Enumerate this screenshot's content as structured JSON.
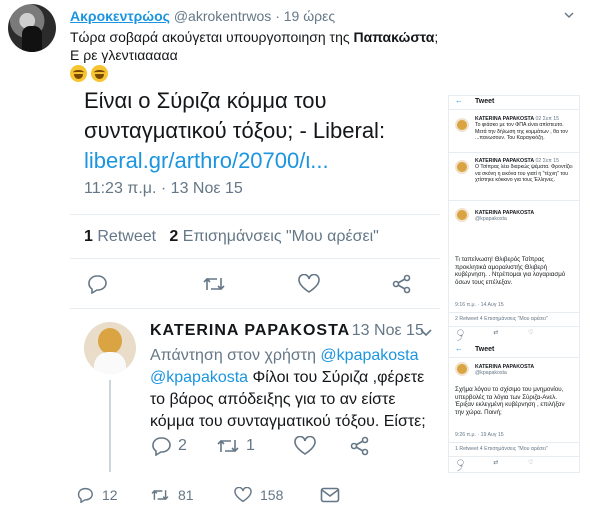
{
  "tweet": {
    "author": "Ακροκεντρώος",
    "handle": "@akrokentrwos",
    "time": "19 ώρες",
    "text_before": "Τώρα σοβαρά ακούγεται υπουργοποιηση της ",
    "text_bold": "Παπακώστα",
    "text_after": ";",
    "line2": "Ε ρε γλεντιααααα",
    "dot": "·"
  },
  "quoted_left": {
    "line1": "Είναι ο Σύριζα κόμμα του",
    "line2": "συνταγματικού τόξου; - Liberal:",
    "link": "liberal.gr/arthro/20700/ι...",
    "datetime": "11:23 π.μ. · 13 Νοε 15",
    "retweets_count": "1",
    "retweets_label": "Retweet",
    "likes_count": "2",
    "likes_label": "Επισημάνσεις \"Μου αρέσει\"",
    "reply": {
      "name": "KATERINA PAPAKOSTA",
      "date": "· 13 Νοε 15",
      "reply_to_label": "Απάντηση στον χρήστη ",
      "reply_to_handle": "@kpapakosta",
      "mention": "@kpapakosta",
      "body": " Φίλοι του Σύριζα ,φέρετε το βάρος απόδειξης για το αν είστε κόμμα του συνταγματικού τόξου. Είστε;",
      "replies": "2",
      "retweets": "1"
    }
  },
  "quoted_right": {
    "title": "Tweet",
    "back": "←",
    "t1": {
      "name": "KATERINA PAPAKOSTA",
      "meta": "02 Σεπ 15",
      "text": "Το φιάσκο με τον ΦΠΑ είναι απίστευτο. Μετά την δήλωση της κομμάτων , θα τον ...πανωσουν. Του Καραγκιόζη."
    },
    "t2": {
      "name": "KATERINA PAPAKOSTA",
      "meta": "02 Σεπ 15",
      "text": "Ο Τσίπρας λέει διαρκώς ψέματα. Φροντίζει να σκόνη η εικόνα του γιατί η \"τέχνη\" του χτίστηκε κόκκινο για τους Έλληνες."
    },
    "t3": {
      "name": "KATERINA PAPAKOSTA",
      "handle": "@kpapakosta",
      "text": "Τι ταπείνωση! Θλιβερός Τσίπρας προκλητικά αμοραλιστής Θλιβερή κυβέρνηση. . Ντρέπομαι για λογαριασμό όσων τους επέλεξαν.",
      "meta": "9:16 π.μ. · 14 Αυγ 15",
      "stats": "2 Retweet   4 Επισημάνσεις \"Μου αρέσει\""
    },
    "t4": {
      "title": "Tweet",
      "name": "KATERINA PAPAKOSTA",
      "handle": "@kpapakosta",
      "text": "Σχήμα λόγου το σχίσιμο του μνημονίου, υπερβολές τα λόγια των Σύριζα-Ανελ. Έριξαν εκλεγμένη κυβέρνηση , επιλήξαν την χώρα. Ποινή;",
      "meta": "9:26 π.μ. · 19 Αυγ 15",
      "stats": "1 Retweet   4 Επισημάνσεις \"Μου αρέσει\""
    }
  },
  "actions": {
    "replies": "12",
    "retweets": "81",
    "likes": "158"
  },
  "colors": {
    "accent": "#1b95e0",
    "secondary_text": "#657786",
    "border": "#e6ecf0"
  }
}
